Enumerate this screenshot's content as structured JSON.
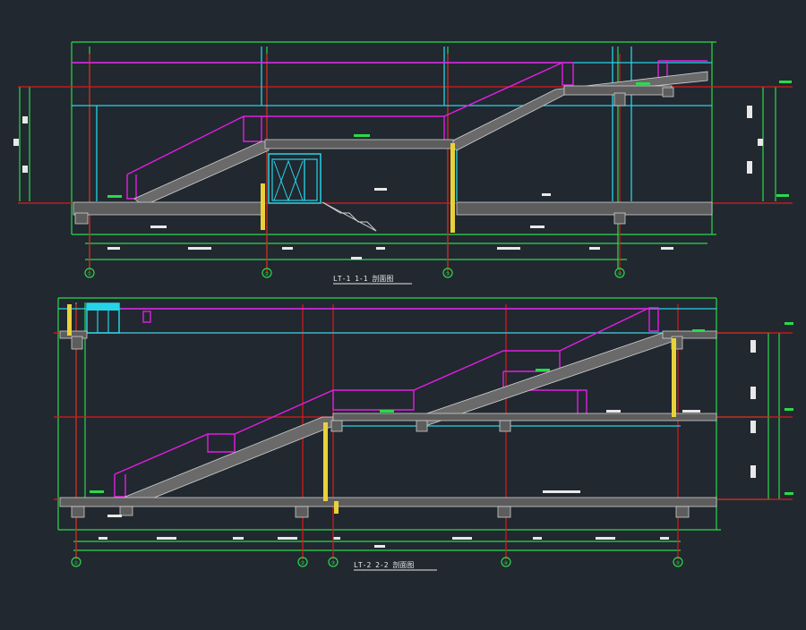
{
  "drawing": {
    "background": "#212830",
    "colors": {
      "green": "#2bd94a",
      "red": "#e01818",
      "cyan": "#27d3e6",
      "magenta": "#e21ee0",
      "yellow": "#e8d23a",
      "gray": "#8a8a8a",
      "white": "#e8e8e8"
    }
  },
  "section_top": {
    "title": "LT-1 1-1 剖面图",
    "axis_labels": [
      "①",
      "②",
      "③",
      "④"
    ]
  },
  "section_bottom": {
    "title": "LT-2 2-2 剖面图",
    "axis_labels": [
      "①",
      "②",
      "③",
      "④",
      "⑤"
    ]
  }
}
